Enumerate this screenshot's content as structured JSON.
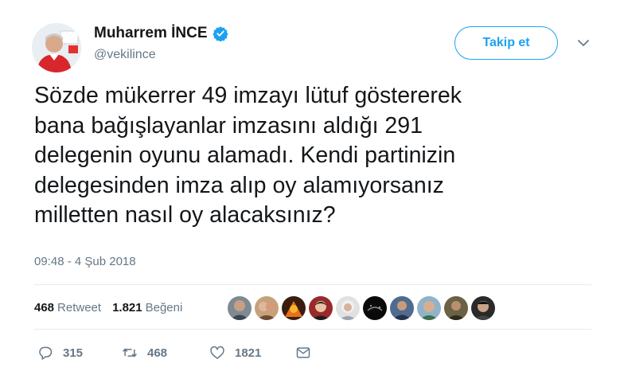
{
  "author": {
    "name": "Muharrem İNCE",
    "handle": "@vekilince",
    "verified": true,
    "verified_color": "#1da1f2"
  },
  "follow_button": {
    "label": "Takip et",
    "color": "#1da1f2"
  },
  "tweet": {
    "text": "Sözde mükerrer 49 imzayı lütuf göstererek\nbana bağışlayanlar imzasını aldığı 291\ndelegenin oyunu alamadı. Kendi partinizin\ndelegesinden imza alıp oy alamıyorsanız\nmilletten nasıl oy alacaksınız?",
    "timestamp": "09:48 - 4 Şub 2018"
  },
  "stats": {
    "retweets_count": "468",
    "retweets_label": "Retweet",
    "likes_count": "1.821",
    "likes_label": "Beğeni"
  },
  "actions": {
    "replies": "315",
    "retweets": "468",
    "likes": "1821"
  },
  "icons": {
    "reply": "reply-icon",
    "retweet": "retweet-icon",
    "like": "heart-icon",
    "message": "envelope-icon",
    "caret": "chevron-down-icon",
    "verified": "verified-badge-icon"
  }
}
